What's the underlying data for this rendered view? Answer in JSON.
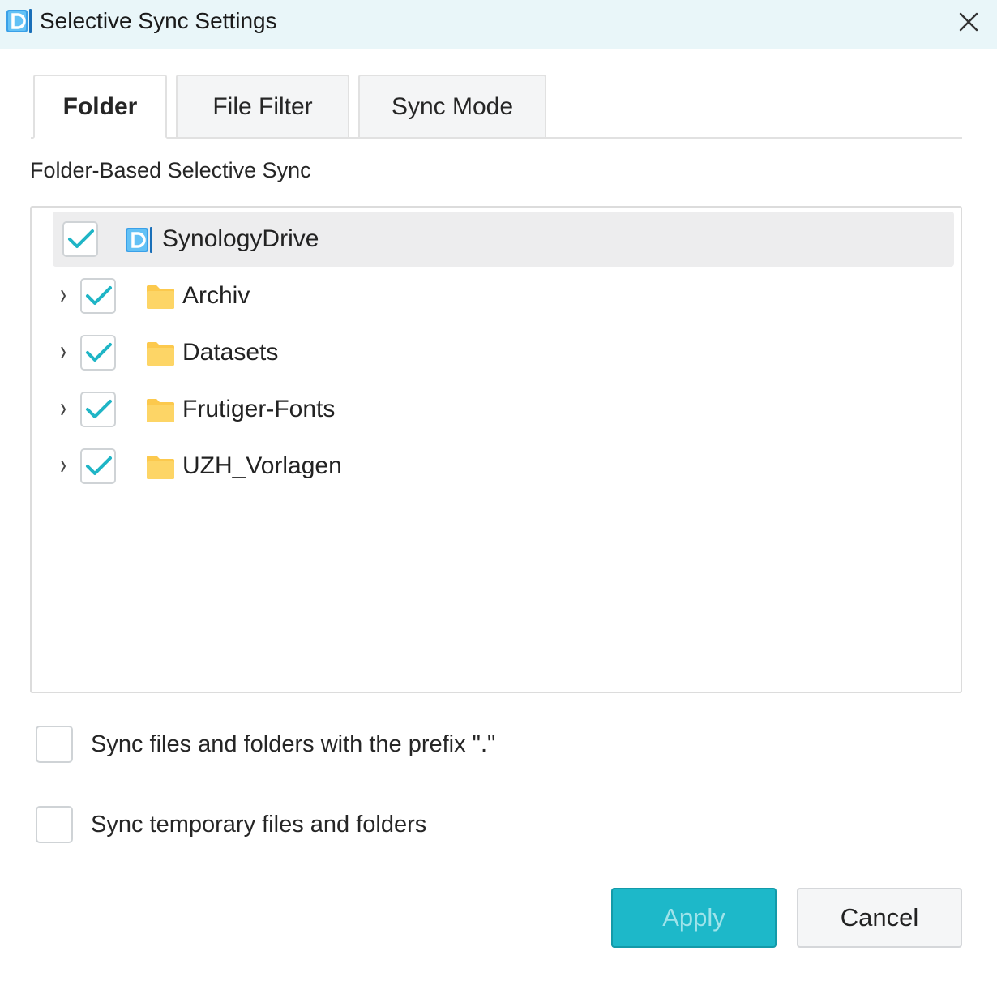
{
  "window": {
    "title": "Selective Sync Settings",
    "app_icon": "synology-drive-icon",
    "close_icon": "close-icon"
  },
  "tabs": [
    {
      "label": "Folder",
      "active": true
    },
    {
      "label": "File Filter",
      "active": false
    },
    {
      "label": "Sync Mode",
      "active": false
    }
  ],
  "section_label": "Folder-Based Selective Sync",
  "tree": {
    "root": {
      "label": "SynologyDrive",
      "checked": true,
      "icon": "synology-drive-icon"
    },
    "children": [
      {
        "label": "Archiv",
        "checked": true,
        "icon": "folder-icon"
      },
      {
        "label": "Datasets",
        "checked": true,
        "icon": "folder-icon"
      },
      {
        "label": "Frutiger-Fonts",
        "checked": true,
        "icon": "folder-icon"
      },
      {
        "label": "UZH_Vorlagen",
        "checked": true,
        "icon": "folder-icon"
      }
    ]
  },
  "options": [
    {
      "label": "Sync files and folders with the prefix \".\"",
      "checked": false
    },
    {
      "label": "Sync temporary files and folders",
      "checked": false
    }
  ],
  "buttons": {
    "apply": "Apply",
    "cancel": "Cancel"
  },
  "colors": {
    "accent": "#1db8c9",
    "check": "#1fb5c6",
    "folder": "#fcc94d",
    "titlebar": "#e9f6f9"
  }
}
